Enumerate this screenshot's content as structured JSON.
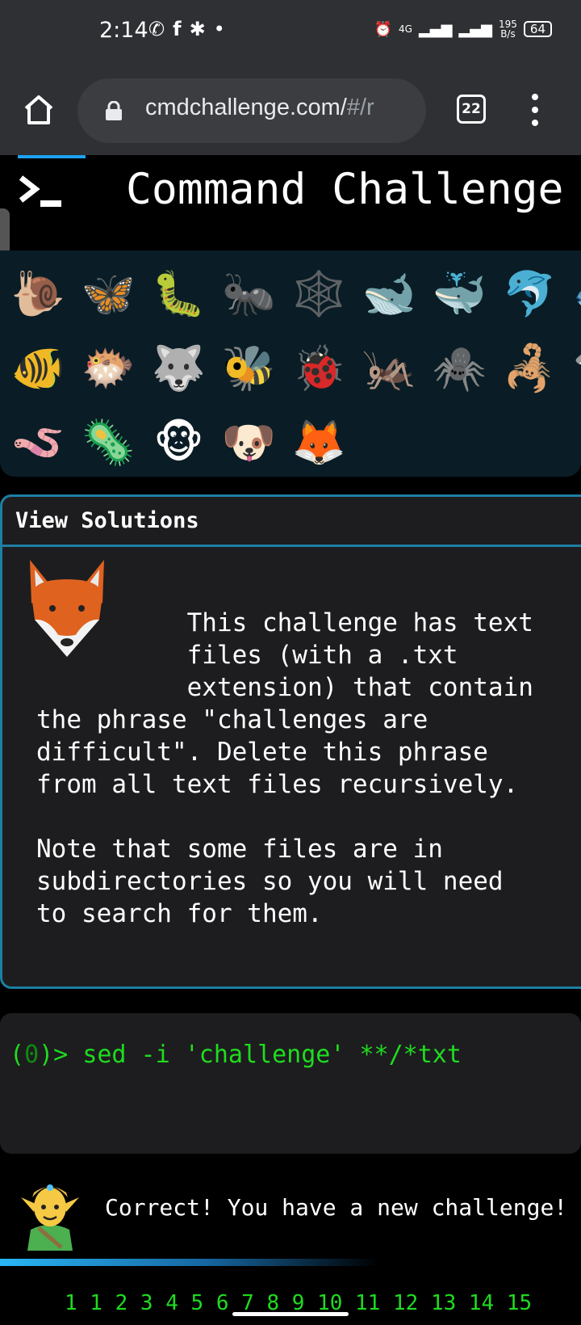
{
  "status_bar": {
    "time": "2:14",
    "net_type": "4G",
    "net_speed_value": "195",
    "net_speed_unit": "B/s",
    "battery": "64",
    "dot": "•"
  },
  "browser": {
    "url_main": "cmdchallenge.com/",
    "url_rest": "#/r",
    "tab_count": "22"
  },
  "header": {
    "title": "Command Challenge"
  },
  "emoji_panel": {
    "rows": [
      [
        "🐌",
        "🦋",
        "🐛",
        "🐜",
        "🕸️",
        "🐋",
        "🐳",
        "🐬",
        "🐟"
      ],
      [
        "🐠",
        "🐡",
        "🐺",
        "🐝",
        "🐞",
        "🦗",
        "🕷️",
        "🦂",
        "🦈"
      ],
      [
        "🪱",
        "🦠",
        "🐵",
        "🐶",
        "🦊"
      ]
    ]
  },
  "challenge": {
    "view_solutions": "View Solutions",
    "description": "          This challenge has text\n          files (with a .txt\n          extension) that contain\nthe phrase \"challenges are\ndifficult\". Delete this phrase\nfrom all text files recursively.\n\nNote that some files are in\nsubdirectories so you will need\nto search for them."
  },
  "terminal": {
    "prompt_open": "(",
    "exit_code": "0",
    "prompt_close": ")> ",
    "command": "sed -i 'challenge' **/*txt"
  },
  "result": {
    "message": "Correct! You have a new challenge!"
  },
  "levels": {
    "text": "1 1 2 3 4 5 6 7 8 9 10 11 12 13 14 15"
  },
  "colors": {
    "accent_blue": "#1d7fa3",
    "terminal_green": "#1fdc1f",
    "chrome_gray": "#2f3033"
  }
}
